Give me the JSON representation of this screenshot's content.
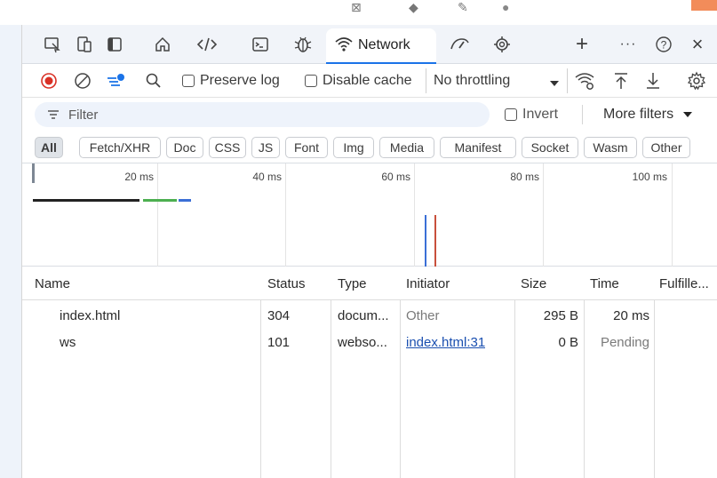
{
  "tabbar": {
    "network_label": "Network"
  },
  "toolbar": {
    "preserve_log_label": "Preserve log",
    "disable_cache_label": "Disable cache",
    "throttling_value": "No throttling"
  },
  "filter": {
    "placeholder": "Filter",
    "invert_label": "Invert",
    "more_filters_label": "More filters"
  },
  "chips": [
    "All",
    "Fetch/XHR",
    "Doc",
    "CSS",
    "JS",
    "Font",
    "Img",
    "Media",
    "Manifest",
    "Socket",
    "Wasm",
    "Other"
  ],
  "overview": {
    "ticks": [
      "20 ms",
      "40 ms",
      "60 ms",
      "80 ms",
      "100 ms"
    ]
  },
  "table": {
    "headers": [
      "Name",
      "Status",
      "Type",
      "Initiator",
      "Size",
      "Time",
      "Fulfille..."
    ],
    "rows": [
      {
        "name": "index.html",
        "status": "304",
        "type": "docum...",
        "initiator": "Other",
        "size": "295 B",
        "time": "20 ms"
      },
      {
        "name": "ws",
        "status": "101",
        "type": "webso...",
        "initiator": "index.html:31",
        "size": "0 B",
        "time": "Pending"
      }
    ]
  },
  "colors": {
    "accent": "#1a73e8",
    "record": "#d93025",
    "timeline_blue": "#3b6fd6",
    "timeline_red": "#c8503c",
    "timeline_green": "#4caf50"
  }
}
